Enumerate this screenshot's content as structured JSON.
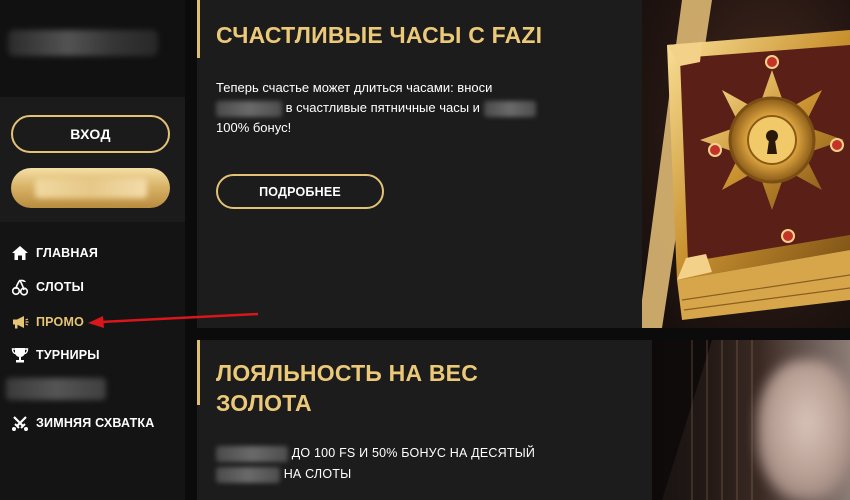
{
  "sidebar": {
    "login_label": "ВХОД",
    "nav": [
      {
        "label": "ГЛАВНАЯ",
        "icon": "home-icon"
      },
      {
        "label": "СЛОТЫ",
        "icon": "cherries-icon"
      },
      {
        "label": "ПРОМО",
        "icon": "megaphone-icon",
        "active": true
      },
      {
        "label": "ТУРНИРЫ",
        "icon": "trophy-icon"
      },
      {
        "label": "ЗИМНЯЯ СХВАТКА",
        "icon": "sword-icon"
      }
    ]
  },
  "promos": [
    {
      "title": "СЧАСТЛИВЫЕ ЧАСЫ С FAZI",
      "desc_part1": "Теперь счастье может длиться часами: вноси",
      "desc_part2": "в счастливые пятничные часы и",
      "desc_part3": "100% бонус!",
      "button": "ПОДРОБНЕЕ"
    },
    {
      "title": "ЛОЯЛЬНОСТЬ НА ВЕС ЗОЛОТА",
      "desc_part1": "ДО 100 FS И 50% БОНУС НА ДЕСЯТЫЙ",
      "desc_part2": "НА СЛОТЫ"
    }
  ],
  "colors": {
    "accent_gold": "#e3c277",
    "annotation_arrow": "#d8161b"
  }
}
